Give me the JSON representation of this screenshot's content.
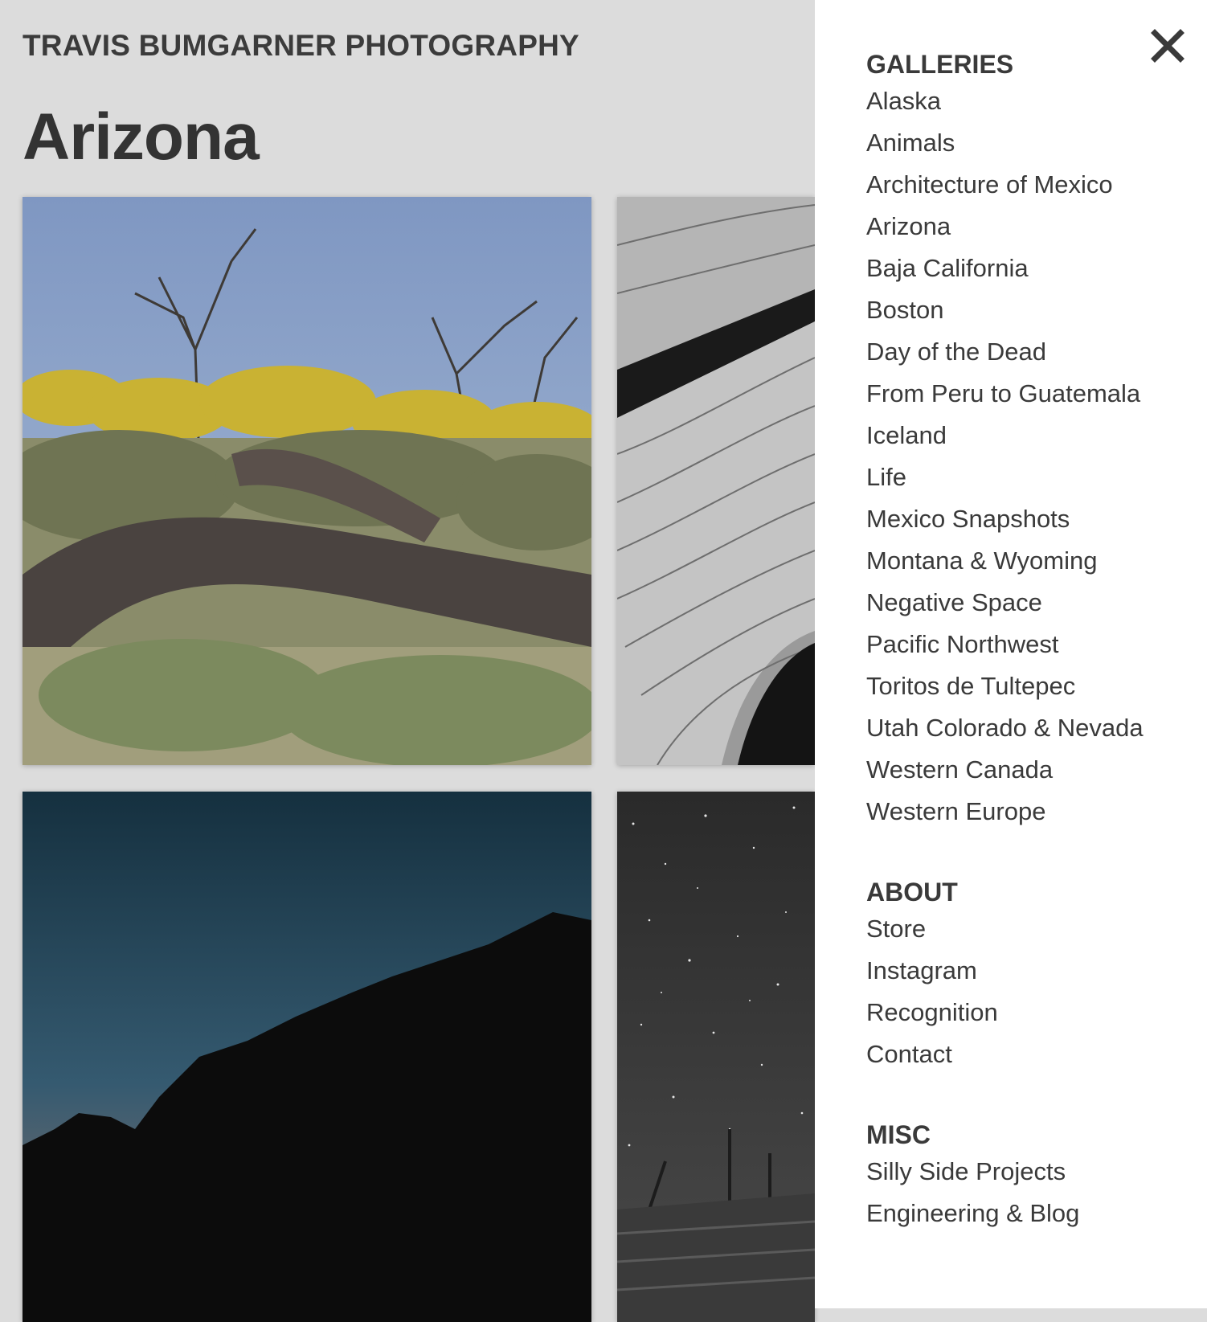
{
  "site": {
    "title": "TRAVIS BUMGARNER PHOTOGRAPHY"
  },
  "page": {
    "title": "Arizona"
  },
  "menu": {
    "sections": [
      {
        "heading": "GALLERIES",
        "items": [
          "Alaska",
          "Animals",
          "Architecture of Mexico",
          "Arizona",
          "Baja California",
          "Boston",
          "Day of the Dead",
          "From Peru to Guatemala",
          "Iceland",
          "Life",
          "Mexico Snapshots",
          "Montana & Wyoming",
          "Negative Space",
          "Pacific Northwest",
          "Toritos de Tultepec",
          "Utah Colorado & Nevada",
          "Western Canada",
          "Western Europe"
        ]
      },
      {
        "heading": "ABOUT",
        "items": [
          "Store",
          "Instagram",
          "Recognition",
          "Contact"
        ]
      },
      {
        "heading": "MISC",
        "items": [
          "Silly Side Projects",
          "Engineering & Blog"
        ]
      }
    ]
  },
  "icons": {
    "close": "close-icon"
  },
  "colors": {
    "overlay_bg": "#dcdcdc",
    "panel_bg": "#ffffff",
    "text": "#3a3a3a"
  }
}
